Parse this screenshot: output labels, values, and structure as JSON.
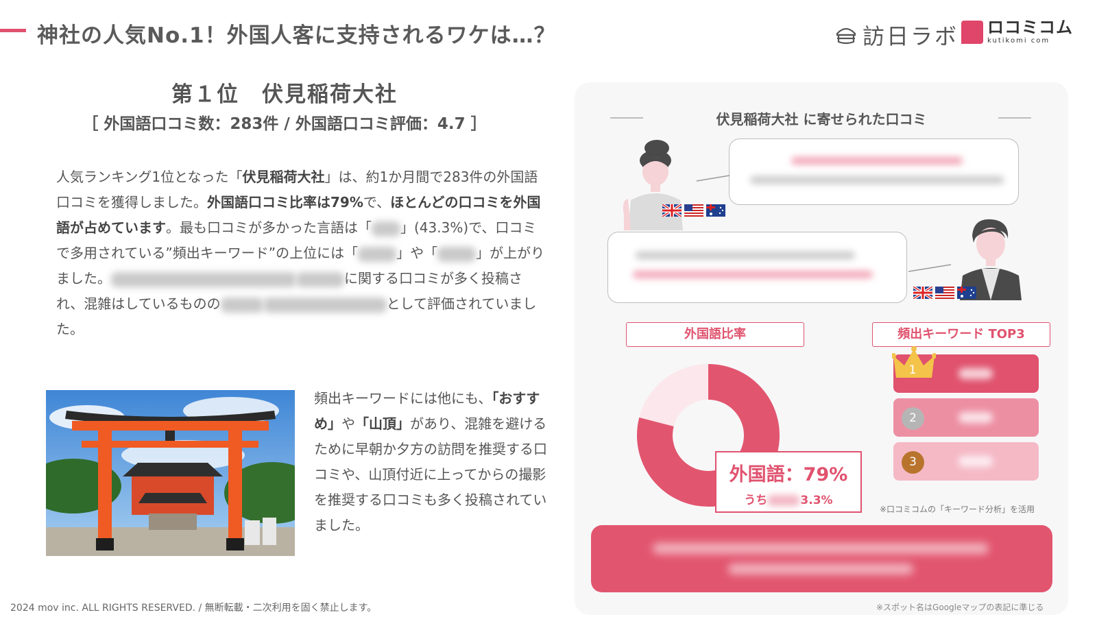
{
  "header": {
    "title": "神社の人気No.1！外国人客に支持されるワケは…？",
    "logo_houjin": "訪日ラボ",
    "logo_kutikomi": "ロコミコム",
    "logo_kutikomi_sub": "kutikomi com"
  },
  "rank": {
    "title": "第１位　伏見稲荷大社",
    "subtitle": "［ 外国語口コミ数：283件 / 外国語口コミ評価：4.7 ］"
  },
  "body": {
    "p1": "人気ランキング1位となった「",
    "p1_bold1": "伏見稲荷大社",
    "p2": "」は、約1か月間で283件の外国語口コミを獲得しました。",
    "p2_bold": "外国語口コミ比率は79%",
    "p3": "で、",
    "p3_bold": "ほとんどの口コミを外国語が占めています",
    "p4": "。最も口コミが多かった言語は「",
    "p5": "」(43.3%)で、口コミで多用されている”頻出キーワード”の上位には「",
    "p6": "」や「",
    "p7": "」が上がりました。",
    "p8": "に関する口コミが多く投稿され、混雑はしているものの",
    "p9": "として評価されていました。"
  },
  "side": {
    "t1": "頻出キーワードには他にも、",
    "b1": "「おすすめ」",
    "t2": "や",
    "b2": "「山頂」",
    "t3": "があり、混雑を避けるために早朝か夕方の訪問を推奨する口コミや、山頂付近に上ってからの撮影を推奨する口コミも多く投稿されていました。"
  },
  "footer": "2024 mov inc. ALL RIGHTS RESERVED. / 無断転載・二次利用を固く禁止します。",
  "panel": {
    "title": "伏見稲荷大社 に寄せられた口コミ",
    "ratio_label": "外国語比率",
    "keyword_label": "頻出キーワード TOP3",
    "ratio_main": "外国語：79%",
    "ratio_sub_prefix": "うち",
    "ratio_sub_suffix": "3.3%",
    "keyword_note": "※口コミコムの「キーワード分析」を活用",
    "spot_note": "※スポット名はGoogleマップの表記に準じる",
    "keyword_ranks": [
      "1",
      "2",
      "3"
    ],
    "foreign_ratio_percent": 79,
    "flags": [
      "uk-flag",
      "us-flag",
      "au-flag"
    ]
  },
  "colors": {
    "accent": "#e0526e",
    "donut_main": "#e2556f",
    "donut_rest": "#fbe7ec",
    "kw1": "#e0526e",
    "kw2": "#ed8fa3",
    "kw3": "#f5b9c6",
    "gold": "#f3c34a",
    "silver": "#b5b5b5",
    "bronze": "#b8742d"
  }
}
